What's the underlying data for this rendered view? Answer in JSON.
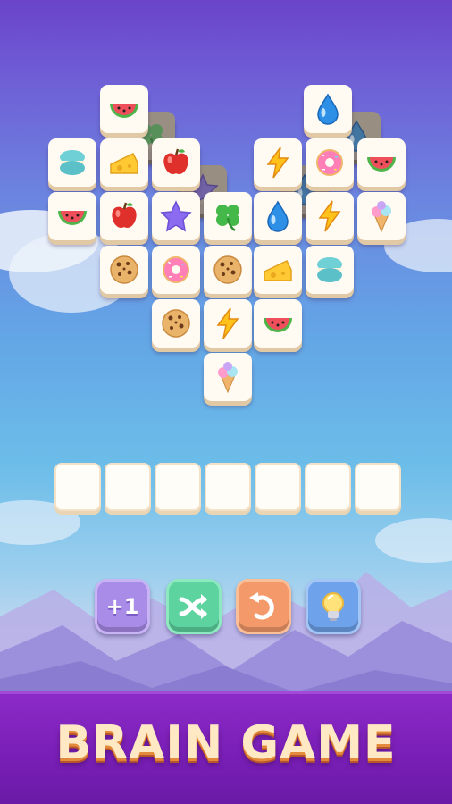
{
  "banner": {
    "title": "BRAIN GAME"
  },
  "powerups": [
    {
      "name": "add-slot",
      "label": "+1",
      "color": "#a98be8"
    },
    {
      "name": "shuffle",
      "icon": "shuffle-arrows-icon",
      "color": "#5dd3a0"
    },
    {
      "name": "undo",
      "icon": "undo-arrow-icon",
      "color": "#f49a6a"
    },
    {
      "name": "hint",
      "icon": "lightbulb-icon",
      "color": "#6ea3ec"
    }
  ],
  "tray": {
    "slot_count": 7,
    "filled": 0
  },
  "tiles": {
    "top_layer": [
      "watermelon",
      "water-drop",
      "macaron",
      "cheese",
      "apple",
      "lightning",
      "donut",
      "watermelon",
      "watermelon",
      "apple",
      "star",
      "clover",
      "water-drop",
      "lightning",
      "ice-cream",
      "cookie",
      "donut",
      "cookie",
      "cheese",
      "macaron",
      "cookie",
      "lightning",
      "watermelon",
      "ice-cream"
    ],
    "under_layer": [
      "clover",
      "water-drop",
      "star",
      "water-drop"
    ]
  }
}
